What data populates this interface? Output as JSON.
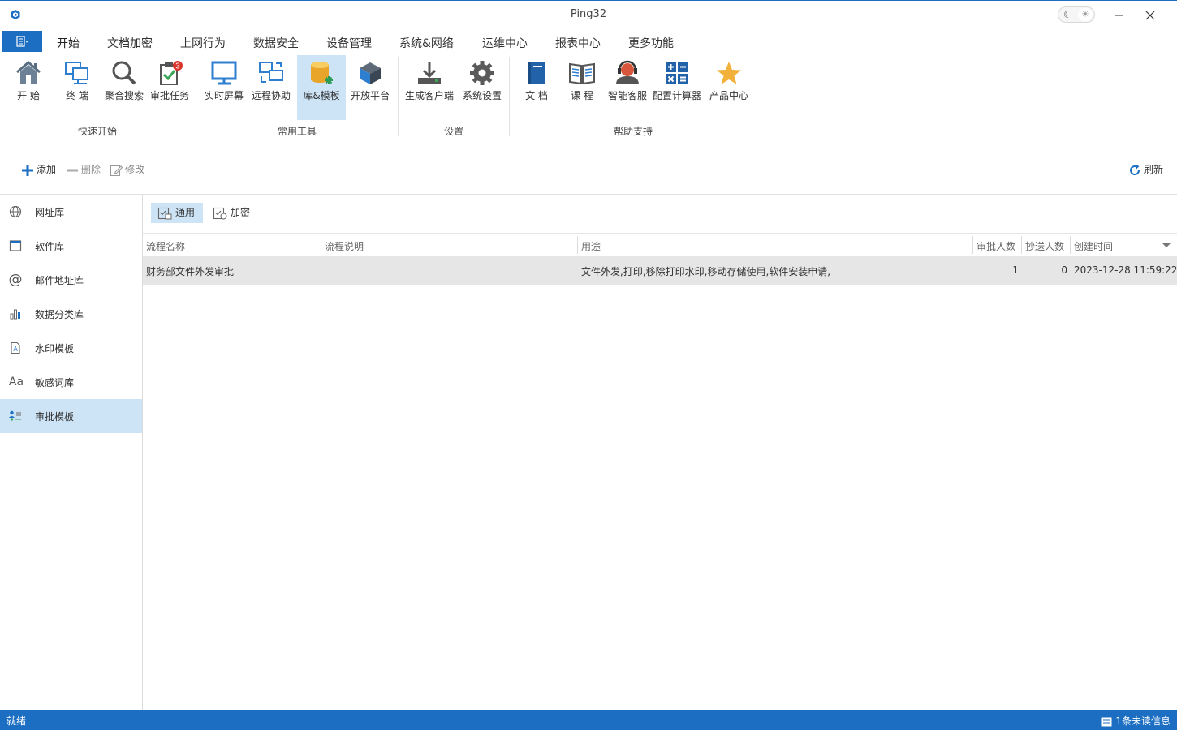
{
  "window": {
    "title": "Ping32"
  },
  "menu": {
    "file_icon": "menu-icon",
    "tabs": [
      {
        "label": "开始"
      },
      {
        "label": "文档加密"
      },
      {
        "label": "上网行为"
      },
      {
        "label": "数据安全"
      },
      {
        "label": "设备管理"
      },
      {
        "label": "系统&网络"
      },
      {
        "label": "运维中心"
      },
      {
        "label": "报表中心"
      },
      {
        "label": "更多功能"
      }
    ]
  },
  "ribbon": {
    "buttons": [
      {
        "label": "开 始",
        "icon": "home-icon"
      },
      {
        "label": "终 端",
        "icon": "terminal-icon"
      },
      {
        "label": "聚合搜索",
        "icon": "search-icon"
      },
      {
        "label": "审批任务",
        "icon": "approval-task-icon",
        "badge": "3"
      },
      {
        "label": "实时屏幕",
        "icon": "monitor-icon"
      },
      {
        "label": "远程协助",
        "icon": "remote-assist-icon"
      },
      {
        "label": "库&模板",
        "icon": "database-icon"
      },
      {
        "label": "开放平台",
        "icon": "cube-icon"
      },
      {
        "label": "生成客户端",
        "icon": "download-icon"
      },
      {
        "label": "系统设置",
        "icon": "gear-icon"
      },
      {
        "label": "文 档",
        "icon": "book-icon"
      },
      {
        "label": "课 程",
        "icon": "open-book-icon"
      },
      {
        "label": "智能客服",
        "icon": "support-agent-icon"
      },
      {
        "label": "配置计算器",
        "icon": "calculator-icon"
      },
      {
        "label": "产品中心",
        "icon": "star-icon"
      }
    ],
    "groups": [
      {
        "label": "快速开始"
      },
      {
        "label": "常用工具"
      },
      {
        "label": "设置"
      },
      {
        "label": "帮助支持"
      }
    ]
  },
  "toolbar": {
    "add_label": "添加",
    "delete_label": "删除",
    "edit_label": "修改",
    "refresh_label": "刷新"
  },
  "sidebar": {
    "items": [
      {
        "label": "网址库",
        "icon": "globe-icon"
      },
      {
        "label": "软件库",
        "icon": "window-icon"
      },
      {
        "label": "邮件地址库",
        "icon": "at-icon"
      },
      {
        "label": "数据分类库",
        "icon": "chart-icon"
      },
      {
        "label": "水印模板",
        "icon": "watermark-icon"
      },
      {
        "label": "敏感词库",
        "icon": "font-icon",
        "glyph": "Aa"
      },
      {
        "label": "审批模板",
        "icon": "approval-template-icon"
      }
    ]
  },
  "subtabs": [
    {
      "label": "通用"
    },
    {
      "label": "加密"
    }
  ],
  "table": {
    "columns": [
      "流程名称",
      "流程说明",
      "用途",
      "审批人数",
      "抄送人数",
      "创建时间"
    ],
    "rows": [
      {
        "name": "财务部文件外发审批",
        "description": "",
        "usage": "文件外发,打印,移除打印水印,移动存储使用,软件安装申请,",
        "approvers": "1",
        "cc": "0",
        "created": "2023-12-28 11:59:22"
      }
    ]
  },
  "statusbar": {
    "left": "就绪",
    "right": "1条未读信息"
  },
  "colors": {
    "accent": "#1b6ec2",
    "selected": "#cde4f7",
    "row_selected": "#e6e6e6"
  }
}
